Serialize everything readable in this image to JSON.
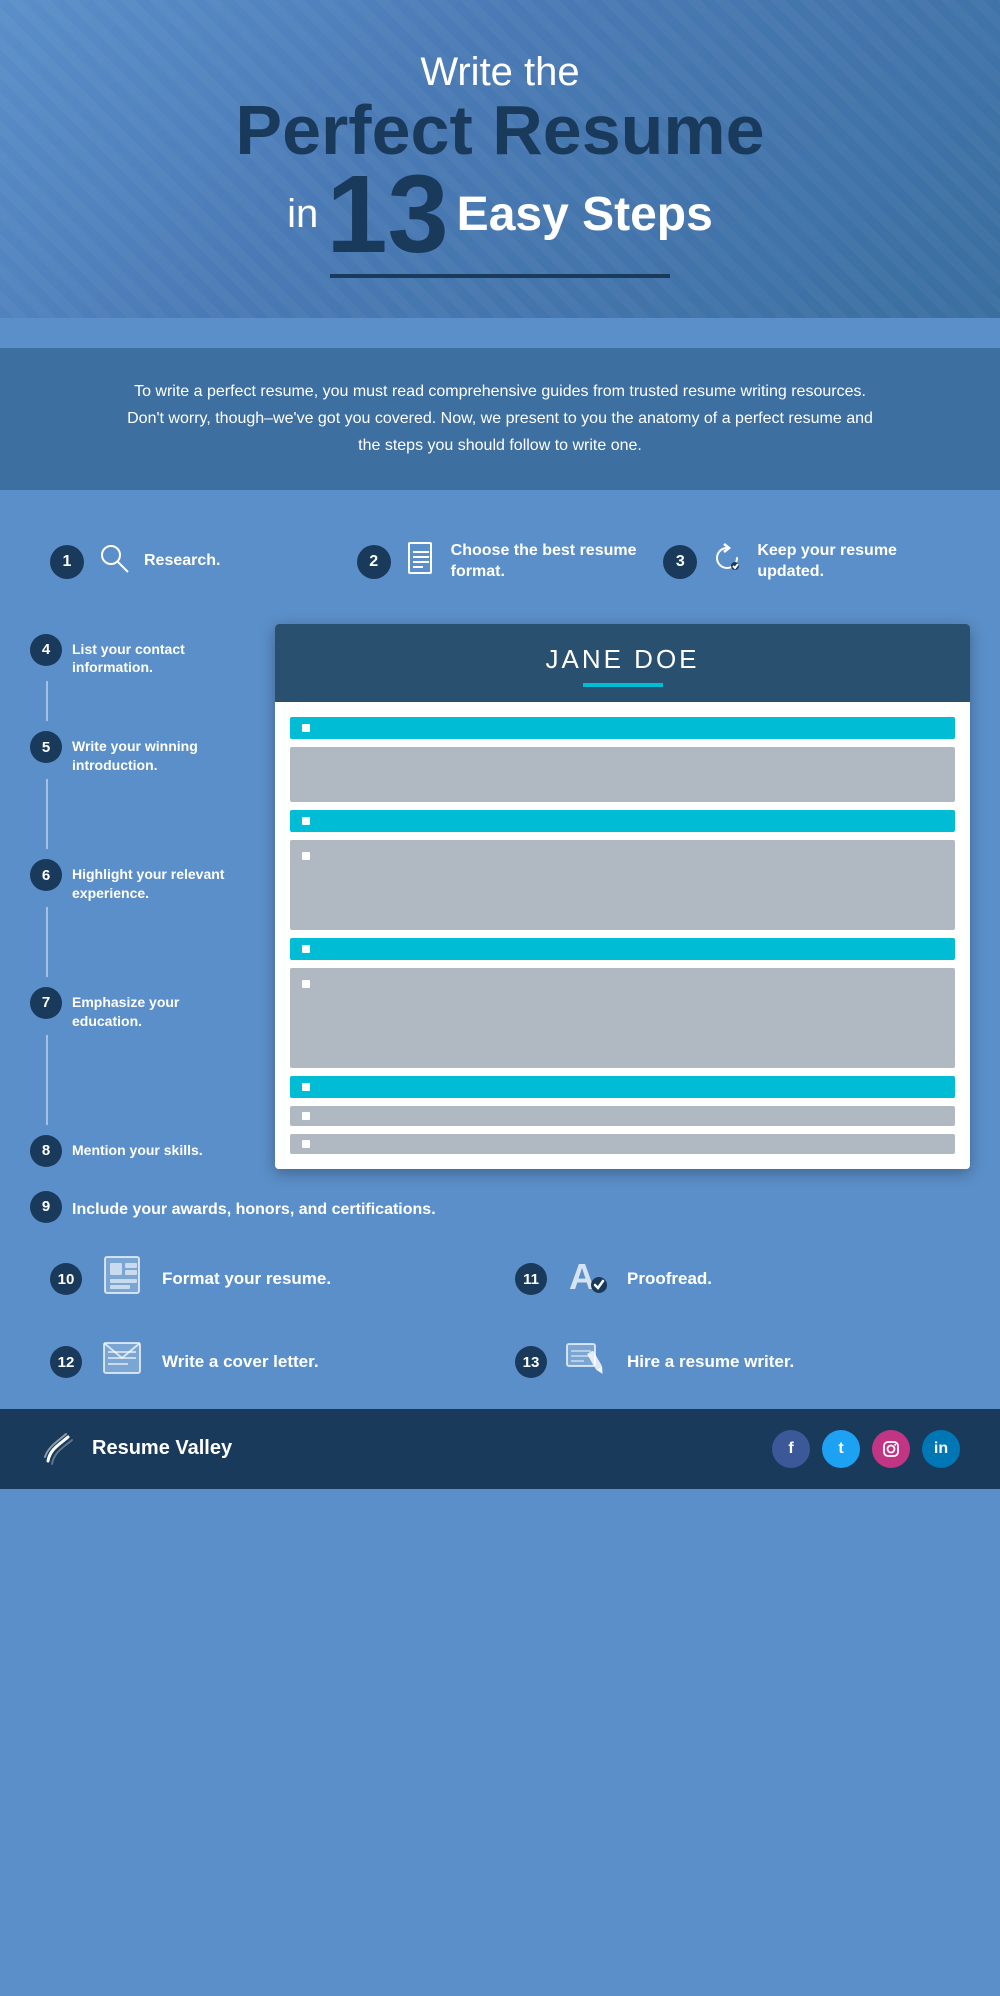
{
  "header": {
    "line1": "Write the",
    "line2": "Perfect Resume",
    "line3_prefix": "in",
    "line3_number": "13",
    "line3_suffix": "Easy Steps"
  },
  "intro": {
    "text": "To write a perfect resume, you must read comprehensive guides from trusted resume writing resources. Don't worry, though–we've got you covered. Now, we present to you the anatomy of a perfect resume and the steps you should follow to write one."
  },
  "steps_top": [
    {
      "number": "1",
      "label": "Research."
    },
    {
      "number": "2",
      "label": "Choose the best resume format."
    },
    {
      "number": "3",
      "label": "Keep your resume updated."
    }
  ],
  "steps_main": [
    {
      "number": "4",
      "label": "List your contact information."
    },
    {
      "number": "5",
      "label": "Write your winning introduction."
    },
    {
      "number": "6",
      "label": "Highlight your relevant experience."
    },
    {
      "number": "7",
      "label": "Emphasize your education."
    },
    {
      "number": "8",
      "label": "Mention your skills."
    }
  ],
  "step9": {
    "number": "9",
    "label": "Include your awards, honors, and certifications."
  },
  "steps_bottom": [
    {
      "number": "10",
      "label": "Format your resume."
    },
    {
      "number": "11",
      "label": "Proofread."
    },
    {
      "number": "12",
      "label": "Write a cover letter."
    },
    {
      "number": "13",
      "label": "Hire a resume writer."
    }
  ],
  "resume_mock": {
    "name": "JANE DOE"
  },
  "footer": {
    "brand": "Resume Valley",
    "social": [
      "f",
      "t",
      "in",
      "li"
    ]
  }
}
